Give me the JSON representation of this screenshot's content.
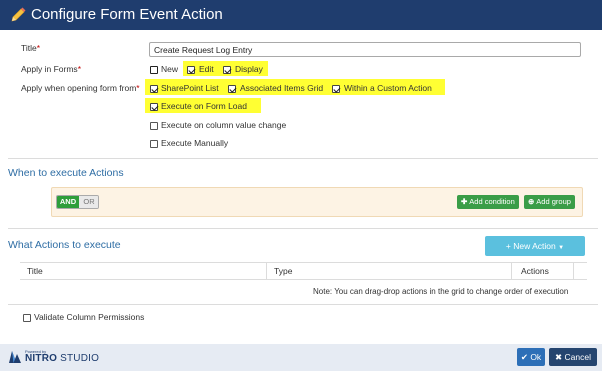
{
  "header": {
    "title": "Configure Form Event Action",
    "icon": "pencil-icon"
  },
  "form": {
    "title_label": "Title",
    "title_value": "Create Request Log Entry",
    "apply_forms_label": "Apply in Forms",
    "apply_forms_options": [
      {
        "label": "New",
        "checked": false
      },
      {
        "label": "Edit",
        "checked": true
      },
      {
        "label": "Display",
        "checked": true
      }
    ],
    "apply_opening_label": "Apply when opening form from",
    "apply_opening_options": [
      {
        "label": "SharePoint List",
        "checked": true
      },
      {
        "label": "Associated Items Grid",
        "checked": true
      },
      {
        "label": "Within a Custom Action",
        "checked": true
      }
    ],
    "execute_options": [
      {
        "label": "Execute on Form Load",
        "checked": true
      },
      {
        "label": "Execute on column value change",
        "checked": false
      },
      {
        "label": "Execute Manually",
        "checked": false
      }
    ],
    "required_marker": "*",
    "highlight_color": "#ffff33"
  },
  "when_section": {
    "title": "When to execute Actions",
    "and_label": "AND",
    "or_label": "OR",
    "add_condition_label": "Add condition",
    "add_group_label": "Add group"
  },
  "actions_section": {
    "title": "What Actions to execute",
    "new_action_label": "+ New Action",
    "columns": [
      "Title",
      "Type",
      "Actions"
    ],
    "note": "Note: You can drag-drop actions in the grid to change order of execution"
  },
  "validate_label": "Validate Column Permissions",
  "footer": {
    "powered_by": "Powered by",
    "brand_bold": "NITRO",
    "brand_light": " STUDIO",
    "ok_label": "Ok",
    "cancel_label": "Cancel"
  },
  "colors": {
    "header_bg": "#1f3d6e",
    "section_title": "#2e6da4",
    "green": "#3a9d47",
    "info": "#5bc0de",
    "ok": "#2d6fb7",
    "cancel": "#25456f"
  }
}
